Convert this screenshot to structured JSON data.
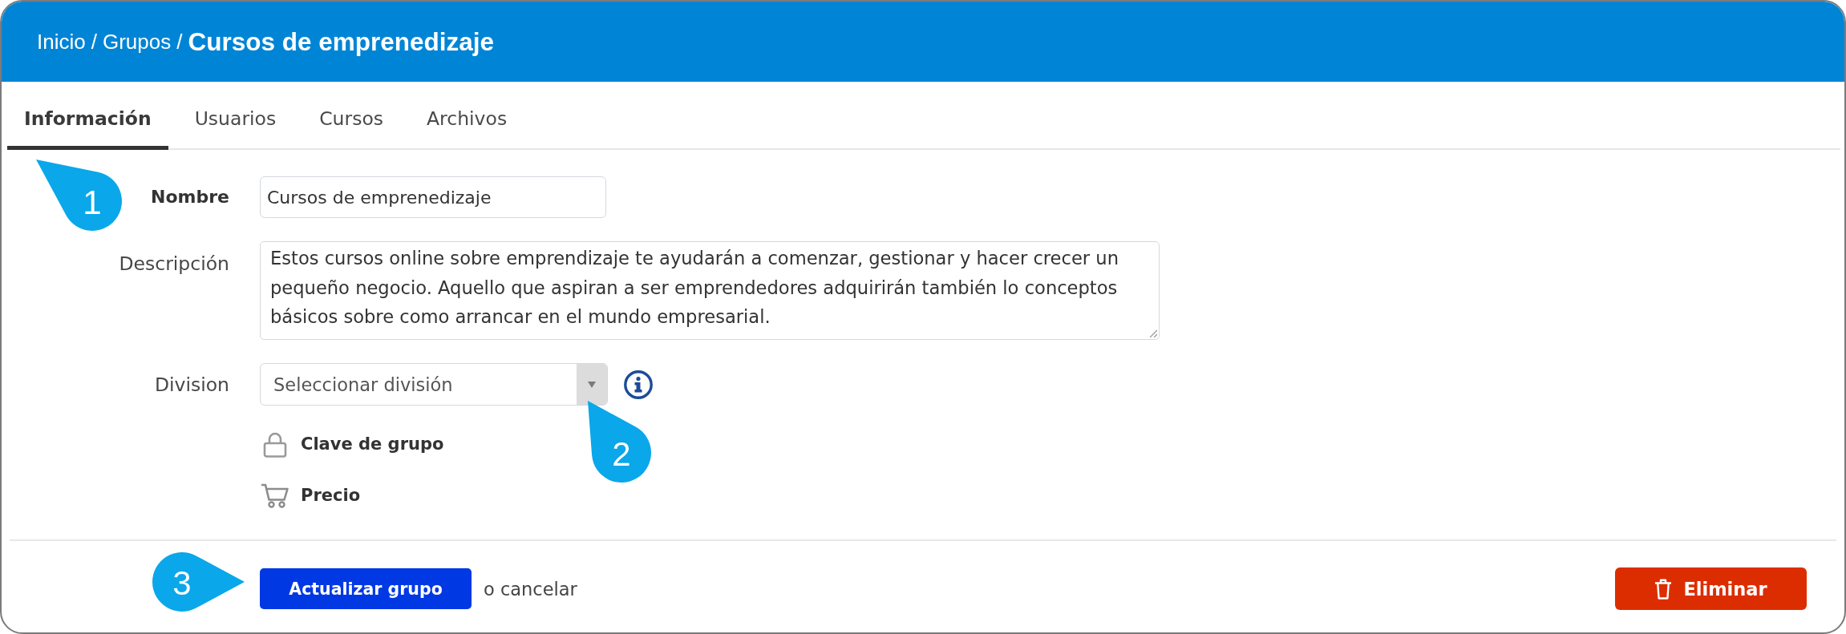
{
  "header": {
    "breadcrumb": [
      {
        "label": "Inicio",
        "separator": "/"
      },
      {
        "label": "Grupos",
        "separator": "/"
      }
    ],
    "title": "Cursos de emprenedizaje"
  },
  "tabs": [
    {
      "label": "Información",
      "selected": true
    },
    {
      "label": "Usuarios",
      "selected": false
    },
    {
      "label": "Cursos",
      "selected": false
    },
    {
      "label": "Archivos",
      "selected": false
    }
  ],
  "form": {
    "fields": [
      {
        "kind": "text",
        "label": "Nombre",
        "required": true,
        "value": "Cursos de emprenedizaje"
      },
      {
        "kind": "textarea",
        "label": "Descripción",
        "required": false,
        "value": "Estos cursos online sobre emprendizaje te ayudarán a comenzar, gestionar y hacer crecer un pequeño negocio. Aquello que aspiran a ser emprendedores adquirirán también lo conceptos básicos sobre como arrancar en el mundo empresarial."
      },
      {
        "kind": "select",
        "label": "Division",
        "required": false,
        "info": true,
        "placeholder": "Seleccionar división"
      }
    ],
    "toggles": [
      {
        "kind": "lock",
        "label": "Clave de grupo"
      },
      {
        "kind": "cart",
        "label": "Precio"
      }
    ]
  },
  "actions": {
    "submit": "Actualizar grupo",
    "cancel": "o cancelar",
    "delete": "Eliminar"
  },
  "callouts": [
    {
      "number": "1"
    },
    {
      "number": "2"
    },
    {
      "number": "3"
    }
  ]
}
